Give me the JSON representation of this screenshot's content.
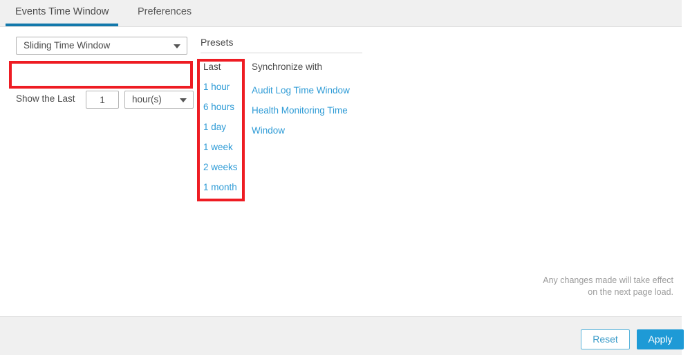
{
  "tabs": [
    {
      "id": "events",
      "label": "Events Time Window",
      "active": true
    },
    {
      "id": "preferences",
      "label": "Preferences",
      "active": false
    }
  ],
  "window_type": {
    "selected": "Sliding Time Window",
    "caret_icon": "chevron-down-icon"
  },
  "show_last": {
    "label": "Show the Last",
    "amount": "1",
    "unit": "hour(s)",
    "caret_icon": "chevron-down-icon"
  },
  "presets": {
    "title": "Presets",
    "last_column": {
      "heading": "Last",
      "items": [
        "1 hour",
        "6 hours",
        "1 day",
        "1 week",
        "2 weeks",
        "1 month"
      ]
    },
    "sync_column": {
      "heading": "Synchronize with",
      "items": [
        "Audit Log Time Window",
        "Health Monitoring Time Window"
      ]
    }
  },
  "note": {
    "line1": "Any changes made will take effect",
    "line2": "on the next page load."
  },
  "footer": {
    "reset_label": "Reset",
    "apply_label": "Apply"
  },
  "colors": {
    "active_tab_underline": "#1278ab",
    "link": "#2e9bd6",
    "apply_button": "#1e9ad6",
    "reset_border": "#5bb6dd",
    "annotation": "#ee1c23",
    "header_bg": "#f0f0f0"
  }
}
